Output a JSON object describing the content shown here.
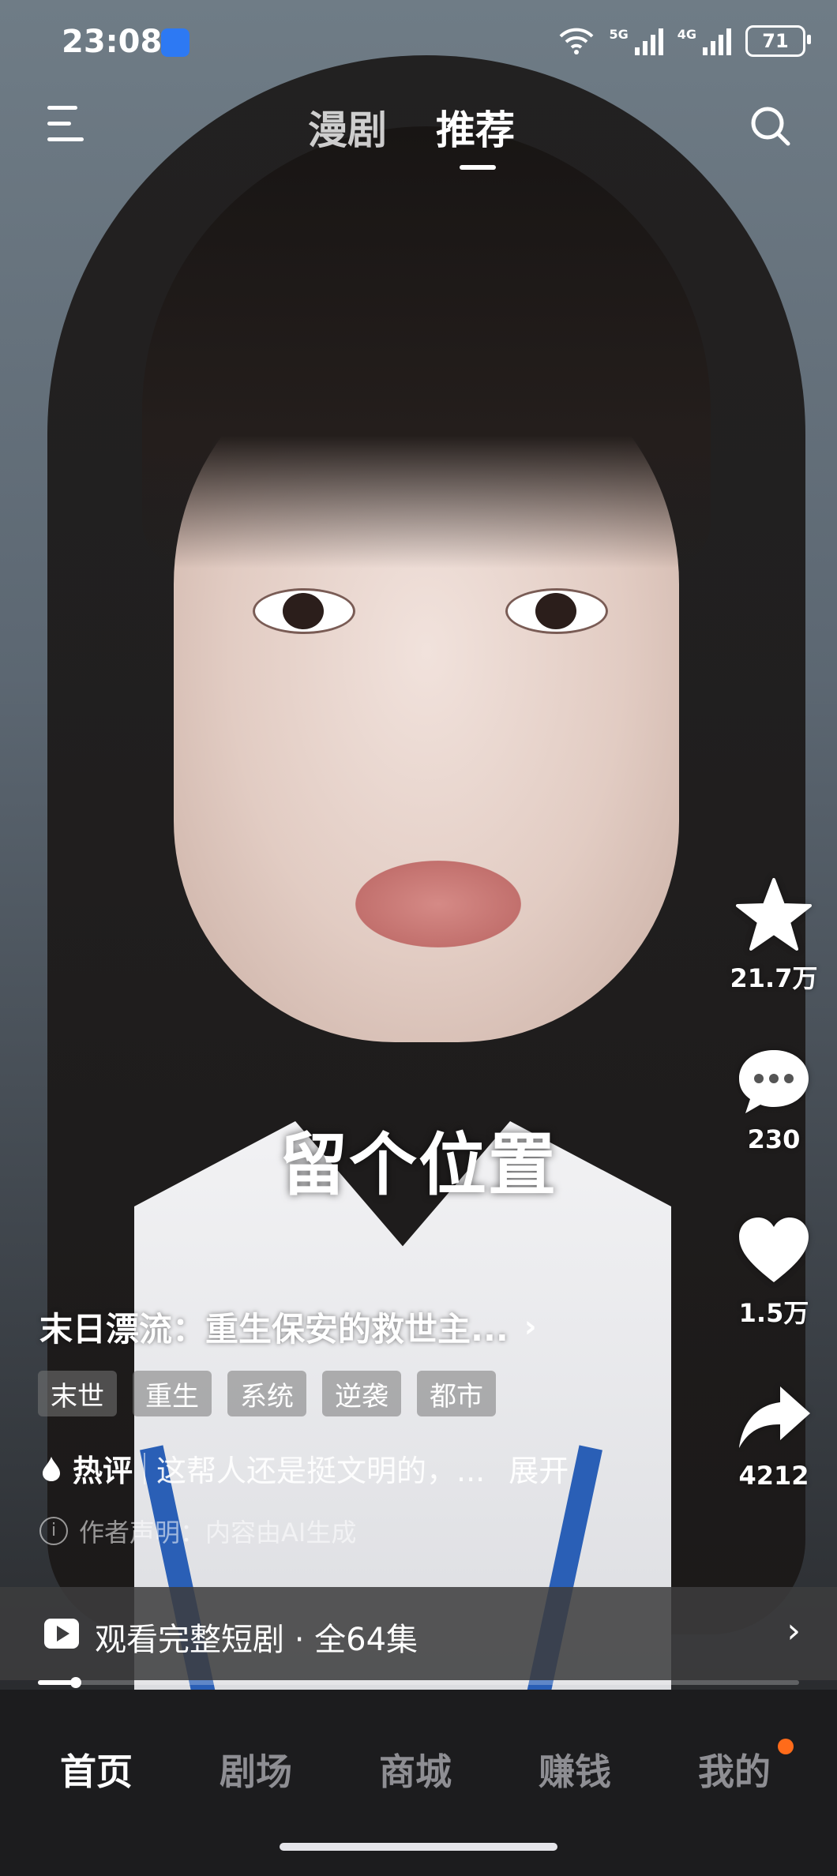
{
  "status_bar": {
    "time": "23:08",
    "net1": "5G",
    "net2": "4G",
    "battery": "71"
  },
  "top_nav": {
    "tabs": [
      {
        "label": "漫剧",
        "active": false
      },
      {
        "label": "推荐",
        "active": true
      }
    ]
  },
  "video": {
    "overlay_caption": "留个位置"
  },
  "actions": {
    "favorite_count": "21.7万",
    "comment_count": "230",
    "like_count": "1.5万",
    "share_count": "4212"
  },
  "info": {
    "title": "末日漂流：重生保安的救世主...",
    "tags": [
      "末世",
      "重生",
      "系统",
      "逆袭",
      "都市"
    ],
    "hot_label": "热评",
    "hot_comment": "这帮人还是挺文明的，...",
    "expand_label": "展开",
    "disclaimer": "作者声明：内容由AI生成"
  },
  "watch_bar": {
    "label": "观看完整短剧 · 全64集",
    "progress": 0.05
  },
  "bottom_nav": {
    "items": [
      {
        "label": "首页",
        "active": true
      },
      {
        "label": "剧场",
        "active": false
      },
      {
        "label": "商城",
        "active": false
      },
      {
        "label": "赚钱",
        "active": false
      },
      {
        "label": "我的",
        "active": false
      }
    ]
  },
  "colors": {
    "accent_dot": "#ff6b1a",
    "app_icon": "#2d79f3"
  }
}
